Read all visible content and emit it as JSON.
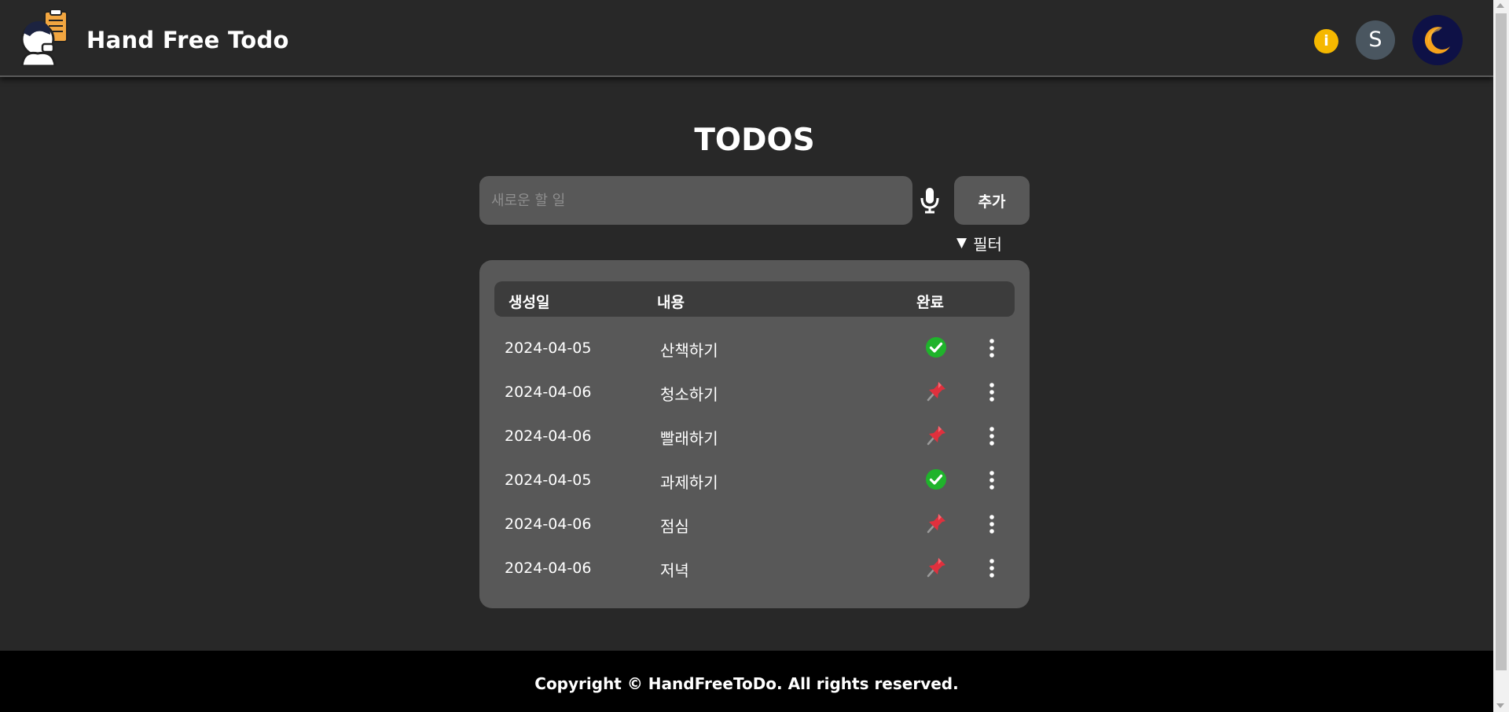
{
  "header": {
    "app_title": "Hand Free Todo",
    "info_label": "i",
    "avatar_initial": "S",
    "logo_icon": "clipboard-person-logo",
    "theme_icon": "moon-icon"
  },
  "main": {
    "title": "TODOS",
    "input_placeholder": "새로운 할 일",
    "input_value": "",
    "add_label": "추가",
    "filter_arrow": "▼",
    "filter_label": "필터"
  },
  "table": {
    "columns": [
      "생성일",
      "내용",
      "완료"
    ],
    "rows": [
      {
        "date": "2024-04-05",
        "text": "산책하기",
        "status": "done"
      },
      {
        "date": "2024-04-06",
        "text": "청소하기",
        "status": "pending"
      },
      {
        "date": "2024-04-06",
        "text": "빨래하기",
        "status": "pending"
      },
      {
        "date": "2024-04-05",
        "text": "과제하기",
        "status": "done"
      },
      {
        "date": "2024-04-06",
        "text": "점심",
        "status": "pending"
      },
      {
        "date": "2024-04-06",
        "text": "저녁",
        "status": "pending"
      }
    ]
  },
  "footer": {
    "copyright": "Copyright © HandFreeToDo. All rights reserved."
  },
  "colors": {
    "background": "#282828",
    "panel": "#585858",
    "info_badge": "#f5b800",
    "done_green": "#1fb32b",
    "pin_red": "#e0303d"
  }
}
